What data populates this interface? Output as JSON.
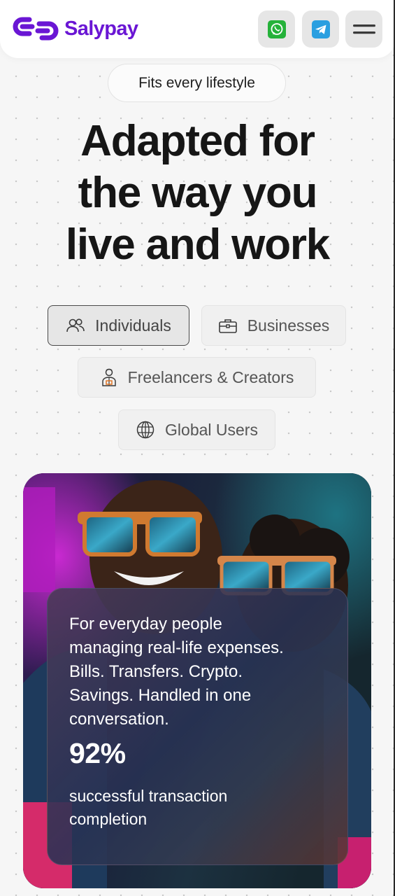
{
  "brand": {
    "name": "Salypay",
    "accent": "#6a16d4"
  },
  "header": {
    "actions": [
      {
        "name": "whatsapp-icon",
        "color": "#25b23a"
      },
      {
        "name": "telegram-icon",
        "color": "#2a9fe0"
      },
      {
        "name": "menu-icon"
      }
    ]
  },
  "hero": {
    "badge": "Fits every lifestyle",
    "title_lines": [
      "Adapted for",
      "the way you",
      "live and work"
    ]
  },
  "segments": [
    {
      "label": "Individuals",
      "icon": "users-icon",
      "selected": true
    },
    {
      "label": "Businesses",
      "icon": "briefcase-icon",
      "selected": false
    },
    {
      "label": "Freelancers & Creators",
      "icon": "creator-icon",
      "selected": false
    },
    {
      "label": "Global Users",
      "icon": "globe-icon",
      "selected": false
    }
  ],
  "card": {
    "description": "For everyday people managing real-life expenses. Bills. Transfers. Crypto. Savings. Handled in one conversation.",
    "stat_value": "92%",
    "stat_label": "successful transaction completion"
  }
}
